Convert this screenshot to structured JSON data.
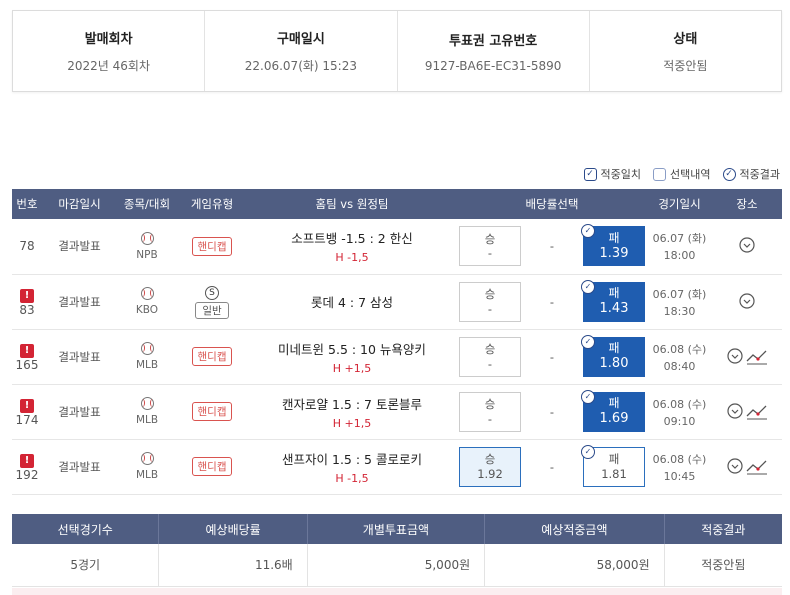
{
  "info": [
    {
      "title": "발매회차",
      "value": "2022년 46회차"
    },
    {
      "title": "구매일시",
      "value": "22.06.07(화) 15:23"
    },
    {
      "title": "투표권 고유번호",
      "value": "9127-BA6E-EC31-5890"
    },
    {
      "title": "상태",
      "value": "적중안됨"
    }
  ],
  "legend": {
    "hit_match": "적중일치",
    "selection": "선택내역",
    "hit_result": "적중결과"
  },
  "table": {
    "headers": {
      "no": "번호",
      "close": "마감일시",
      "sport": "종목/대회",
      "type": "게임유형",
      "match": "홈팀 vs 원정팀",
      "odds": "배당률선택",
      "date": "경기일시",
      "place": "장소"
    },
    "rows": [
      {
        "no": "78",
        "alert": "",
        "close": "결과발표",
        "league": "NPB",
        "type": "핸디캡",
        "type_kind": "handicap",
        "match": "소프트뱅 -1.5 : 2 한신",
        "sub": "H -1,5",
        "win_label": "승",
        "win_val": "-",
        "draw": "-",
        "lose_label": "패",
        "lose_val": "1.39",
        "lose_state": "hit",
        "win_state": "plain",
        "date": "06.07 (화)",
        "time": "18:00",
        "trend": false
      },
      {
        "no": "83",
        "alert": "!",
        "close": "결과발표",
        "league": "KBO",
        "type": "일반",
        "type_kind": "normal",
        "type_icon": "S",
        "match": "롯데 4 : 7 삼성",
        "sub": "",
        "win_label": "승",
        "win_val": "-",
        "draw": "-",
        "lose_label": "패",
        "lose_val": "1.43",
        "lose_state": "hit",
        "win_state": "plain",
        "date": "06.07 (화)",
        "time": "18:30",
        "trend": false
      },
      {
        "no": "165",
        "alert": "!",
        "close": "결과발표",
        "league": "MLB",
        "type": "핸디캡",
        "type_kind": "handicap",
        "match": "미네트윈 5.5 : 10 뉴욕양키",
        "sub": "H +1,5",
        "win_label": "승",
        "win_val": "-",
        "draw": "-",
        "lose_label": "패",
        "lose_val": "1.80",
        "lose_state": "hit",
        "win_state": "plain",
        "date": "06.08 (수)",
        "time": "08:40",
        "trend": true
      },
      {
        "no": "174",
        "alert": "!",
        "close": "결과발표",
        "league": "MLB",
        "type": "핸디캡",
        "type_kind": "handicap",
        "match": "캔자로얄 1.5 : 7 토론블루",
        "sub": "H +1,5",
        "win_label": "승",
        "win_val": "-",
        "draw": "-",
        "lose_label": "패",
        "lose_val": "1.69",
        "lose_state": "hit",
        "win_state": "plain",
        "date": "06.08 (수)",
        "time": "09:10",
        "trend": true
      },
      {
        "no": "192",
        "alert": "!",
        "close": "결과발표",
        "league": "MLB",
        "type": "핸디캡",
        "type_kind": "handicap",
        "match": "샌프자이 1.5 : 5 콜로로키",
        "sub": "H -1,5",
        "win_label": "승",
        "win_val": "1.92",
        "draw": "-",
        "lose_label": "패",
        "lose_val": "1.81",
        "lose_state": "outline",
        "win_state": "selected",
        "date": "06.08 (수)",
        "time": "10:45",
        "trend": true
      }
    ]
  },
  "summary": {
    "headers": [
      "선택경기수",
      "예상배당률",
      "개별투표금액",
      "예상적중금액",
      "적중결과"
    ],
    "values": [
      "5경기",
      "11.6배",
      "5,000원",
      "58,000원",
      "적중안됨"
    ]
  },
  "icons": {
    "check": "check-icon",
    "baseball": "baseball-icon",
    "pin": "map-pin-icon",
    "trend": "trend-chart-icon",
    "alert": "alert-icon"
  },
  "colors": {
    "header_bg": "#4f5d82",
    "hit_blue": "#1f5db0",
    "alert_red": "#d32434"
  }
}
